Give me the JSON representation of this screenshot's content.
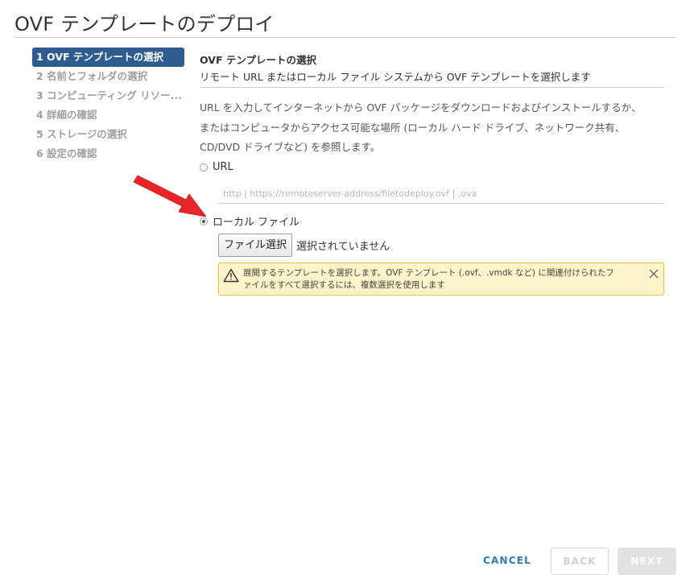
{
  "window": {
    "title": "OVF テンプレートのデプロイ"
  },
  "steps": [
    {
      "label": "1 OVF テンプレートの選択",
      "active": true
    },
    {
      "label": "2 名前とフォルダの選択",
      "active": false
    },
    {
      "label": "3 コンピューティング リソー...",
      "active": false
    },
    {
      "label": "4 詳細の確認",
      "active": false
    },
    {
      "label": "5 ストレージの選択",
      "active": false
    },
    {
      "label": "6 設定の確認",
      "active": false
    }
  ],
  "content": {
    "section_title": "OVF テンプレートの選択",
    "section_subtitle": "リモート URL またはローカル ファイル システムから OVF テンプレートを選択します",
    "description_lines": [
      "URL を入力してインターネットから OVF パッケージをダウンロードおよびインストールするか、",
      "またはコンピュータからアクセス可能な場所 (ローカル ハード ドライブ、ネットワーク共有、",
      "CD/DVD ドライブなど) を参照します。"
    ],
    "url_option": {
      "label": "URL",
      "selected": false,
      "placeholder": "http | https://remoteserver-address/filetodeploy.ovf | .ova",
      "value": ""
    },
    "local_option": {
      "label": "ローカル ファイル",
      "selected": true
    },
    "file_button_label": "ファイル選択",
    "file_status": "選択されていません",
    "alert": {
      "lines": [
        "展開するテンプレートを選択します。OVF テンプレート (.ovf、.vmdk など) に関連付けられたフ",
        "ァイルをすべて選択するには、複数選択を使用します"
      ],
      "icon": "warning-icon"
    }
  },
  "footer": {
    "cancel_label": "CANCEL",
    "back_label": "BACK",
    "next_label": "NEXT"
  },
  "colors": {
    "accent": "#2f5c8f",
    "link": "#2a79ad",
    "alert_bg": "#fdf4c9",
    "alert_border": "#eac434",
    "arrow": "#e8262a"
  }
}
